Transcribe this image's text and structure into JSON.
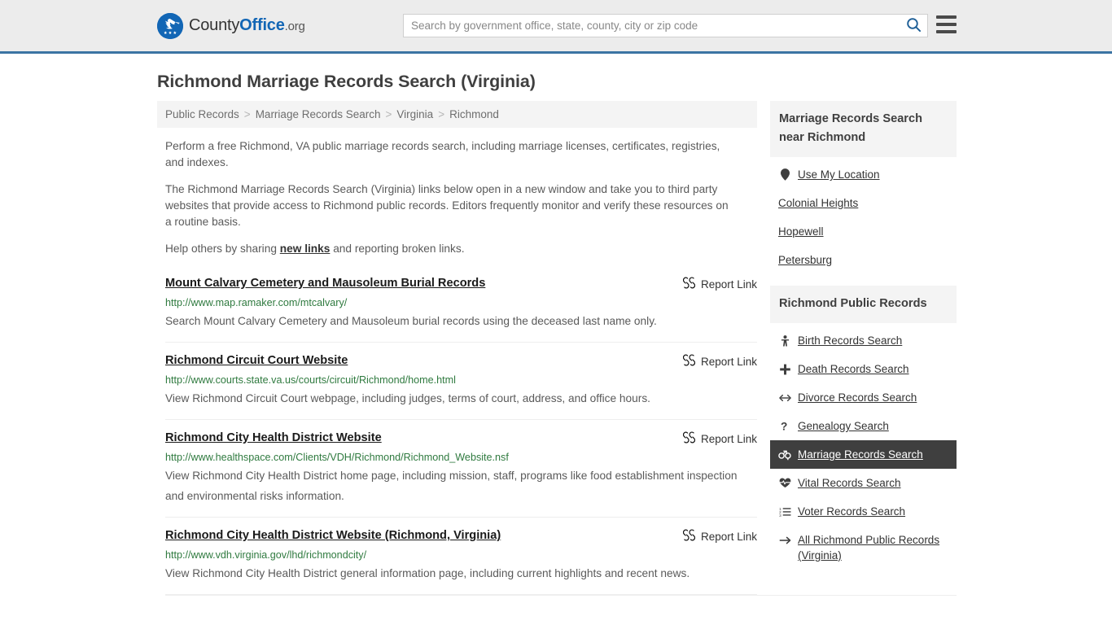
{
  "header": {
    "logo": {
      "icon": "eagle-seal-icon",
      "text_county": "County",
      "text_office": "Office",
      "text_org": ".org"
    },
    "search": {
      "placeholder": "Search by government office, state, county, city or zip code",
      "value": "",
      "button_icon": "search-icon"
    },
    "menu_icon": "hamburger-menu-icon"
  },
  "page": {
    "title": "Richmond Marriage Records Search (Virginia)"
  },
  "breadcrumb": {
    "separator": ">",
    "items": [
      {
        "label": "Public Records"
      },
      {
        "label": "Marriage Records Search"
      },
      {
        "label": "Virginia"
      },
      {
        "label": "Richmond"
      }
    ]
  },
  "intro": {
    "p1": "Perform a free Richmond, VA public marriage records search, including marriage licenses, certificates, registries, and indexes.",
    "p2": "The Richmond Marriage Records Search (Virginia) links below open in a new window and take you to third party websites that provide access to Richmond public records. Editors frequently monitor and verify these resources on a routine basis.",
    "p3_before": "Help others by sharing ",
    "p3_link": "new links",
    "p3_after": " and reporting broken links."
  },
  "results": {
    "report_label": "Report Link",
    "report_icon": "broken-link-icon",
    "items": [
      {
        "title": "Mount Calvary Cemetery and Mausoleum Burial Records",
        "url": "http://www.map.ramaker.com/mtcalvary/",
        "description": "Search Mount Calvary Cemetery and Mausoleum burial records using the deceased last name only."
      },
      {
        "title": "Richmond Circuit Court Website",
        "url": "http://www.courts.state.va.us/courts/circuit/Richmond/home.html",
        "description": "View Richmond Circuit Court webpage, including judges, terms of court, address, and office hours."
      },
      {
        "title": "Richmond City Health District Website",
        "url": "http://www.healthspace.com/Clients/VDH/Richmond/Richmond_Website.nsf",
        "description": "View Richmond City Health District home page, including mission, staff, programs like food establishment inspection and environmental risks information."
      },
      {
        "title": "Richmond City Health District Website (Richmond, Virginia)",
        "url": "http://www.vdh.virginia.gov/lhd/richmondcity/",
        "description": "View Richmond City Health District general information page, including current highlights and recent news."
      }
    ]
  },
  "sidebar": {
    "nearby": {
      "heading": "Marriage Records Search near Richmond",
      "items": [
        {
          "label": "Use My Location",
          "icon": "map-pin-icon",
          "active": false
        },
        {
          "label": "Colonial Heights",
          "icon": "",
          "active": false
        },
        {
          "label": "Hopewell",
          "icon": "",
          "active": false
        },
        {
          "label": "Petersburg",
          "icon": "",
          "active": false
        }
      ]
    },
    "public_records": {
      "heading": "Richmond Public Records",
      "items": [
        {
          "label": "Birth Records Search",
          "icon": "baby-icon",
          "active": false
        },
        {
          "label": "Death Records Search",
          "icon": "cross-icon",
          "active": false
        },
        {
          "label": "Divorce Records Search",
          "icon": "left-right-arrow-icon",
          "active": false
        },
        {
          "label": "Genealogy Search",
          "icon": "question-mark-icon",
          "active": false
        },
        {
          "label": "Marriage Records Search",
          "icon": "mars-venus-icon",
          "active": true
        },
        {
          "label": "Vital Records Search",
          "icon": "heartbeat-icon",
          "active": false
        },
        {
          "label": "Voter Records Search",
          "icon": "list-ol-icon",
          "active": false
        },
        {
          "label": "All Richmond Public Records (Virginia)",
          "icon": "arrow-right-icon",
          "active": false
        }
      ]
    }
  },
  "colors": {
    "brand_blue": "#1266b5",
    "header_border": "#3b74a3",
    "url_green": "#2f7a3f",
    "active_bg": "#3f3f3f",
    "panel_gray": "#f4f4f4"
  }
}
